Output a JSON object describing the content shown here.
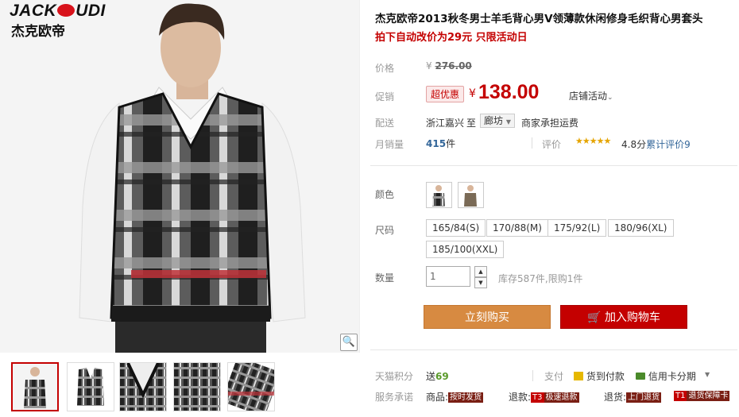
{
  "brand": {
    "name_en_a": "JACK",
    "name_en_b": "UDI",
    "name_cn": "杰克欧帝"
  },
  "product": {
    "title": "杰克欧帝2013秋冬男士羊毛背心男V领薄款休闲修身毛织背心男套头",
    "promo": "拍下自动改价为29元 只限活动日"
  },
  "price": {
    "label": "价格",
    "currency": "¥",
    "original": "276.00",
    "promo_label": "促销",
    "promo_badge": "超优惠",
    "promo_price": "138.00",
    "shop_activity": "店铺活动"
  },
  "shipping": {
    "label": "配送",
    "origin": "浙江嘉兴",
    "to": "至",
    "destination": "廊坊",
    "fee_note": "商家承担运费"
  },
  "sales": {
    "label": "月销量",
    "count": "415",
    "unit": "件",
    "review_label": "评价",
    "stars": "★★★★★",
    "score": "4.8分",
    "review_link": "累计评价9"
  },
  "colors": {
    "label": "颜色"
  },
  "sizes": {
    "label": "尺码",
    "options": [
      "165/84(S)",
      "170/88(M)",
      "175/92(L)",
      "180/96(XL)",
      "185/100(XXL)"
    ]
  },
  "quantity": {
    "label": "数量",
    "value": "1",
    "stock": "库存587件,限购1件"
  },
  "buttons": {
    "buy_now": "立刻购买",
    "add_to_cart": "加入购物车"
  },
  "tmall_points": {
    "label": "天猫积分",
    "prefix": "送",
    "value": "69"
  },
  "payment": {
    "label": "支付",
    "cod": "货到付款",
    "credit": "信用卡分期"
  },
  "service": {
    "label": "服务承诺",
    "items": [
      {
        "pre": "商品:",
        "badge": "按时发货"
      },
      {
        "pre": "退款:",
        "icon": "T3",
        "badge": "极速退款"
      },
      {
        "pre": "退货:",
        "badge": "上门退货"
      },
      {
        "icon": "T1",
        "badge": "退货保障卡"
      }
    ]
  },
  "colors_theme": {
    "accent": "#c40000",
    "buy_button": "#d78a41",
    "link": "#336699"
  }
}
